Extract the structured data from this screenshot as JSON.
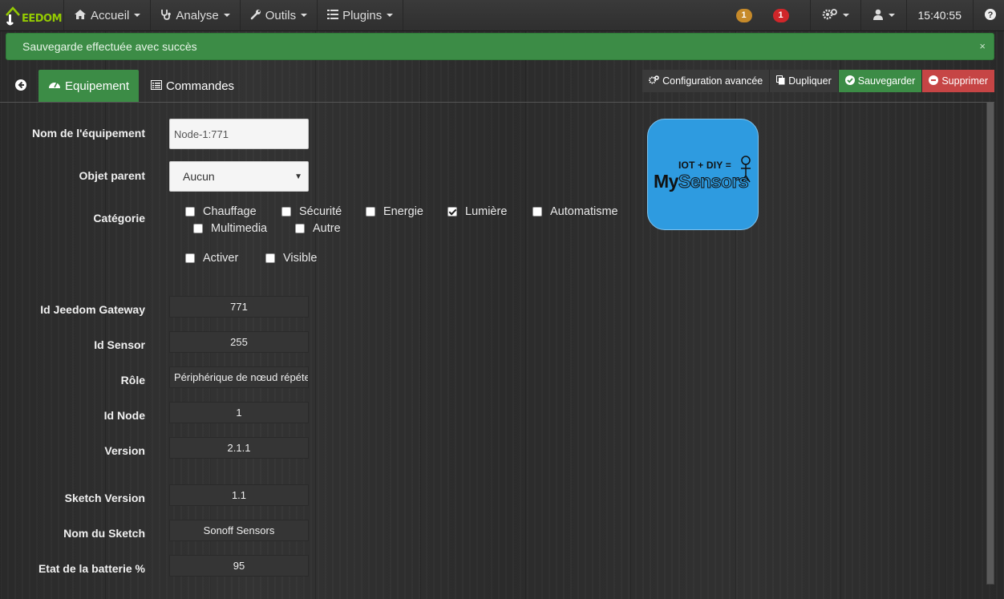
{
  "navbar": {
    "brand": "EEDOM",
    "menus": [
      {
        "label": "Accueil",
        "icon": "home-icon"
      },
      {
        "label": "Analyse",
        "icon": "stethoscope-icon"
      },
      {
        "label": "Outils",
        "icon": "wrench-icon"
      },
      {
        "label": "Plugins",
        "icon": "tasks-icon"
      }
    ],
    "badge_orange": "1",
    "badge_red": "1",
    "time": "15:40:55"
  },
  "alert": {
    "message": "Sauvegarde effectuée avec succès",
    "close": "×"
  },
  "tabs": [
    {
      "label": "Equipement",
      "icon": "tachometer-icon"
    },
    {
      "label": "Commandes",
      "icon": "list-alt-icon"
    }
  ],
  "actions": {
    "config": "Configuration avancée",
    "duplicate": "Dupliquer",
    "save": "Sauvegarder",
    "delete": "Supprimer"
  },
  "form": {
    "name_label": "Nom de l'équipement",
    "name_value": "Node-1:771",
    "parent_label": "Objet parent",
    "parent_value": "Aucun",
    "category_label": "Catégorie",
    "categories": [
      {
        "label": "Chauffage",
        "checked": false
      },
      {
        "label": "Sécurité",
        "checked": false
      },
      {
        "label": "Energie",
        "checked": false
      },
      {
        "label": "Lumière",
        "checked": true
      },
      {
        "label": "Automatisme",
        "checked": false
      },
      {
        "label": "Multimedia",
        "checked": false
      },
      {
        "label": "Autre",
        "checked": false
      }
    ],
    "activate": "Activer",
    "visible": "Visible",
    "fields": [
      {
        "label": "Id Jeedom Gateway",
        "value": "771"
      },
      {
        "label": "Id Sensor",
        "value": "255"
      },
      {
        "label": "Rôle",
        "value": "Périphérique de nœud répéteur"
      },
      {
        "label": "Id Node",
        "value": "1"
      },
      {
        "label": "Version",
        "value": "2.1.1"
      },
      {
        "label": "Sketch Version",
        "value": "1.1"
      },
      {
        "label": "Nom du Sketch",
        "value": "Sonoff Sensors"
      },
      {
        "label": "Etat de la batterie %",
        "value": "95"
      }
    ]
  },
  "logo": {
    "top": "IOT + DIY =",
    "my": "My",
    "sensors": "Sensors"
  }
}
